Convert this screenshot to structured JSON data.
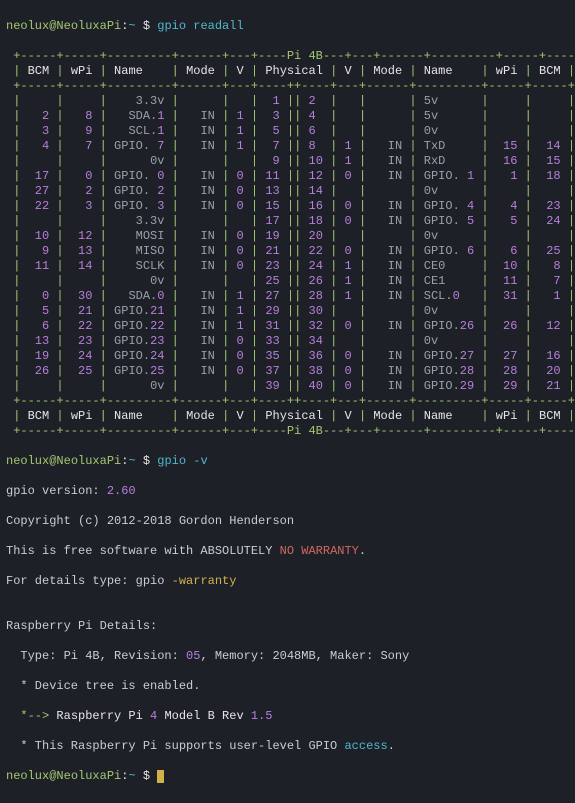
{
  "prompt": {
    "user": "neolux",
    "host": "NeoluxaPi",
    "path": "~",
    "symbol": "$"
  },
  "commands": {
    "c1": "gpio readall",
    "c2": "gpio -v",
    "c3": ""
  },
  "table": {
    "title": "Pi 4B",
    "headers": [
      "BCM",
      "wPi",
      "Name",
      "Mode",
      "V",
      "Physical",
      "V",
      "Mode",
      "Name",
      "wPi",
      "BCM"
    ],
    "rows": [
      {
        "l": {
          "bcm": "",
          "wpi": "",
          "name": "3.3v",
          "mode": "",
          "v": ""
        },
        "pin": [
          1,
          2
        ],
        "r": {
          "v": "",
          "mode": "",
          "name": "5v",
          "wpi": "",
          "bcm": ""
        }
      },
      {
        "l": {
          "bcm": 2,
          "wpi": 8,
          "name": "SDA.1",
          "mode": "IN",
          "v": 1
        },
        "pin": [
          3,
          4
        ],
        "r": {
          "v": "",
          "mode": "",
          "name": "5v",
          "wpi": "",
          "bcm": ""
        }
      },
      {
        "l": {
          "bcm": 3,
          "wpi": 9,
          "name": "SCL.1",
          "mode": "IN",
          "v": 1
        },
        "pin": [
          5,
          6
        ],
        "r": {
          "v": "",
          "mode": "",
          "name": "0v",
          "wpi": "",
          "bcm": ""
        }
      },
      {
        "l": {
          "bcm": 4,
          "wpi": 7,
          "name": "GPIO. 7",
          "mode": "IN",
          "v": 1
        },
        "pin": [
          7,
          8
        ],
        "r": {
          "v": 1,
          "mode": "IN",
          "name": "TxD",
          "wpi": 15,
          "bcm": 14
        }
      },
      {
        "l": {
          "bcm": "",
          "wpi": "",
          "name": "0v",
          "mode": "",
          "v": ""
        },
        "pin": [
          9,
          10
        ],
        "r": {
          "v": 1,
          "mode": "IN",
          "name": "RxD",
          "wpi": 16,
          "bcm": 15
        }
      },
      {
        "l": {
          "bcm": 17,
          "wpi": 0,
          "name": "GPIO. 0",
          "mode": "IN",
          "v": 0
        },
        "pin": [
          11,
          12
        ],
        "r": {
          "v": 0,
          "mode": "IN",
          "name": "GPIO. 1",
          "wpi": 1,
          "bcm": 18
        }
      },
      {
        "l": {
          "bcm": 27,
          "wpi": 2,
          "name": "GPIO. 2",
          "mode": "IN",
          "v": 0
        },
        "pin": [
          13,
          14
        ],
        "r": {
          "v": "",
          "mode": "",
          "name": "0v",
          "wpi": "",
          "bcm": ""
        }
      },
      {
        "l": {
          "bcm": 22,
          "wpi": 3,
          "name": "GPIO. 3",
          "mode": "IN",
          "v": 0
        },
        "pin": [
          15,
          16
        ],
        "r": {
          "v": 0,
          "mode": "IN",
          "name": "GPIO. 4",
          "wpi": 4,
          "bcm": 23
        }
      },
      {
        "l": {
          "bcm": "",
          "wpi": "",
          "name": "3.3v",
          "mode": "",
          "v": ""
        },
        "pin": [
          17,
          18
        ],
        "r": {
          "v": 0,
          "mode": "IN",
          "name": "GPIO. 5",
          "wpi": 5,
          "bcm": 24
        }
      },
      {
        "l": {
          "bcm": 10,
          "wpi": 12,
          "name": "MOSI",
          "mode": "IN",
          "v": 0
        },
        "pin": [
          19,
          20
        ],
        "r": {
          "v": "",
          "mode": "",
          "name": "0v",
          "wpi": "",
          "bcm": ""
        }
      },
      {
        "l": {
          "bcm": 9,
          "wpi": 13,
          "name": "MISO",
          "mode": "IN",
          "v": 0
        },
        "pin": [
          21,
          22
        ],
        "r": {
          "v": 0,
          "mode": "IN",
          "name": "GPIO. 6",
          "wpi": 6,
          "bcm": 25
        }
      },
      {
        "l": {
          "bcm": 11,
          "wpi": 14,
          "name": "SCLK",
          "mode": "IN",
          "v": 0
        },
        "pin": [
          23,
          24
        ],
        "r": {
          "v": 1,
          "mode": "IN",
          "name": "CE0",
          "wpi": 10,
          "bcm": 8
        }
      },
      {
        "l": {
          "bcm": "",
          "wpi": "",
          "name": "0v",
          "mode": "",
          "v": ""
        },
        "pin": [
          25,
          26
        ],
        "r": {
          "v": 1,
          "mode": "IN",
          "name": "CE1",
          "wpi": 11,
          "bcm": 7
        }
      },
      {
        "l": {
          "bcm": 0,
          "wpi": 30,
          "name": "SDA.0",
          "mode": "IN",
          "v": 1
        },
        "pin": [
          27,
          28
        ],
        "r": {
          "v": 1,
          "mode": "IN",
          "name": "SCL.0",
          "wpi": 31,
          "bcm": 1
        }
      },
      {
        "l": {
          "bcm": 5,
          "wpi": 21,
          "name": "GPIO.21",
          "mode": "IN",
          "v": 1
        },
        "pin": [
          29,
          30
        ],
        "r": {
          "v": "",
          "mode": "",
          "name": "0v",
          "wpi": "",
          "bcm": ""
        }
      },
      {
        "l": {
          "bcm": 6,
          "wpi": 22,
          "name": "GPIO.22",
          "mode": "IN",
          "v": 1
        },
        "pin": [
          31,
          32
        ],
        "r": {
          "v": 0,
          "mode": "IN",
          "name": "GPIO.26",
          "wpi": 26,
          "bcm": 12
        }
      },
      {
        "l": {
          "bcm": 13,
          "wpi": 23,
          "name": "GPIO.23",
          "mode": "IN",
          "v": 0
        },
        "pin": [
          33,
          34
        ],
        "r": {
          "v": "",
          "mode": "",
          "name": "0v",
          "wpi": "",
          "bcm": ""
        }
      },
      {
        "l": {
          "bcm": 19,
          "wpi": 24,
          "name": "GPIO.24",
          "mode": "IN",
          "v": 0
        },
        "pin": [
          35,
          36
        ],
        "r": {
          "v": 0,
          "mode": "IN",
          "name": "GPIO.27",
          "wpi": 27,
          "bcm": 16
        }
      },
      {
        "l": {
          "bcm": 26,
          "wpi": 25,
          "name": "GPIO.25",
          "mode": "IN",
          "v": 0
        },
        "pin": [
          37,
          38
        ],
        "r": {
          "v": 0,
          "mode": "IN",
          "name": "GPIO.28",
          "wpi": 28,
          "bcm": 20
        }
      },
      {
        "l": {
          "bcm": "",
          "wpi": "",
          "name": "0v",
          "mode": "",
          "v": ""
        },
        "pin": [
          39,
          40
        ],
        "r": {
          "v": 0,
          "mode": "IN",
          "name": "GPIO.29",
          "wpi": 29,
          "bcm": 21
        }
      }
    ]
  },
  "version": {
    "line1a": "gpio version: ",
    "line1b": "2.60",
    "line2": "Copyright (c) 2012-2018 Gordon Henderson",
    "line3a": "This is free software with ABSOLUTELY ",
    "line3b": "NO WARRANTY",
    "line3c": ".",
    "line4a": "For details type: gpio ",
    "line4b": "-warranty",
    "blank": "",
    "rp_hdr": "Raspberry Pi Details:",
    "rp1a": "  Type: Pi 4B, Revision: ",
    "rp1b": "05",
    "rp1c": ", Memory: 2048MB, Maker: Sony",
    "rp2": "  * Device tree is enabled.",
    "rp3a": "  *--> ",
    "rp3b": "Raspberry Pi ",
    "rp3c": "4",
    "rp3d": " Model B Rev ",
    "rp3e": "1.5",
    "rp4a": "  * This Raspberry Pi supports user-level GPIO ",
    "rp4b": "access",
    "rp4c": "."
  }
}
